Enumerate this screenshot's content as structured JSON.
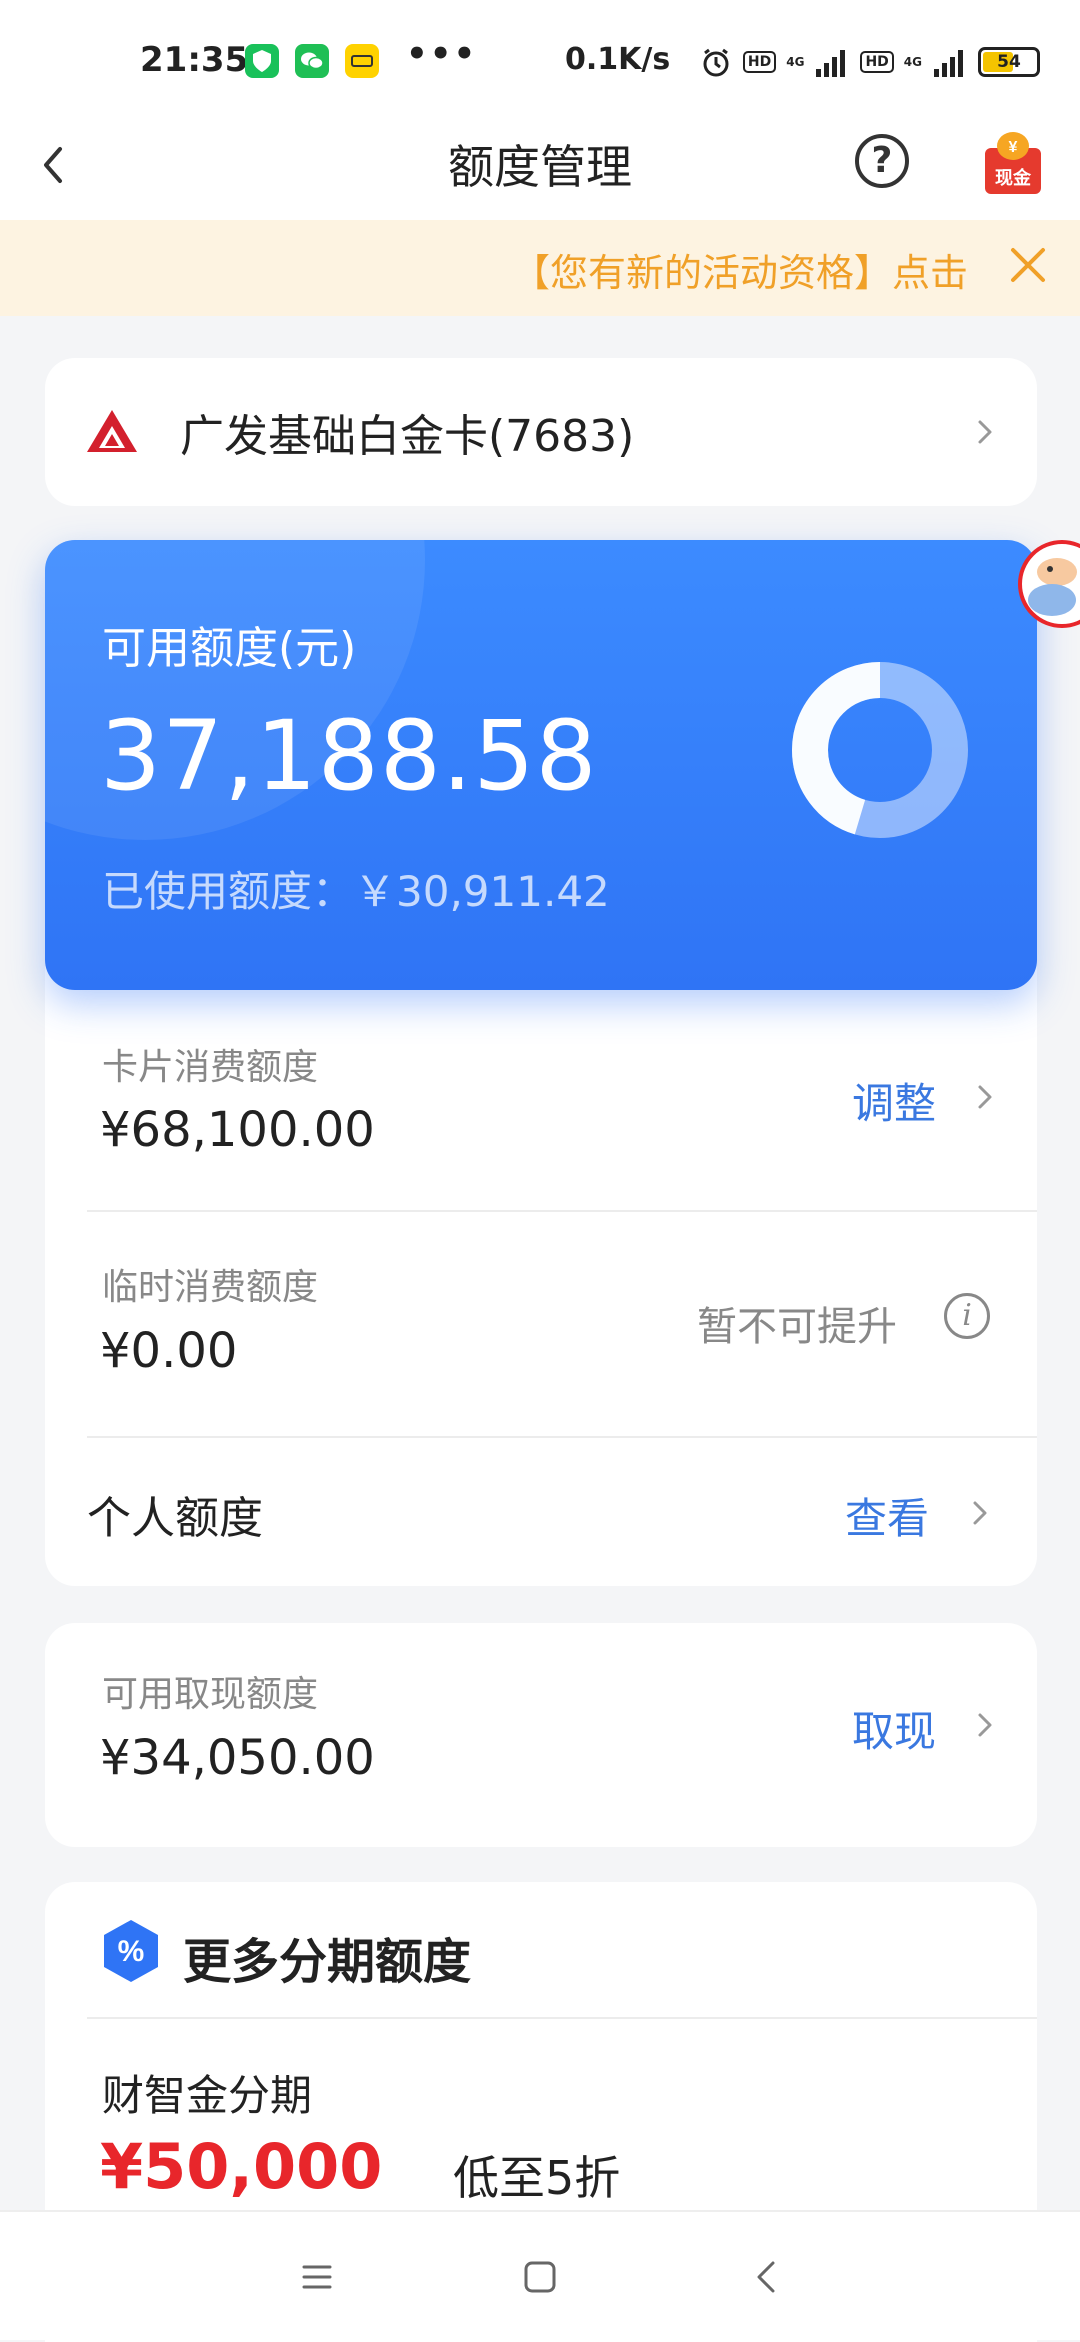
{
  "status_bar": {
    "time": "21:35",
    "net_speed": "0.1K/s",
    "hd1": "HD",
    "net1": "4G",
    "hd2": "HD",
    "net2": "4G",
    "battery": "54",
    "app_icons": [
      "shield-app-icon",
      "wechat-icon",
      "xianyu-app-icon"
    ],
    "app_colors": [
      "#19c15a",
      "#1fbf55",
      "#ffd200"
    ]
  },
  "nav": {
    "title": "额度管理",
    "help": "?",
    "cash_icon_text_1": "¥",
    "cash_icon_text_2": "现金"
  },
  "banner": {
    "text": "【您有新的活动资格】点击"
  },
  "card_select": {
    "name": "广发基础白金卡(7683)"
  },
  "available": {
    "label": "可用额度(元)",
    "amount": "37,188.58",
    "used_label": "已使用额度：",
    "used_amount": "￥30,911.42",
    "used_ratio": 0.454
  },
  "limits": {
    "card_limit_label": "卡片消费额度",
    "card_limit_value": "¥68,100.00",
    "card_limit_action": "调整",
    "temp_limit_label": "临时消费额度",
    "temp_limit_value": "¥0.00",
    "temp_limit_status": "暂不可提升",
    "personal_label": "个人额度",
    "personal_action": "查看"
  },
  "cash": {
    "label": "可用取现额度",
    "value": "¥34,050.00",
    "action": "取现"
  },
  "installment": {
    "title": "更多分期额度",
    "icon_text": "%",
    "product": "财智金分期",
    "amount": "¥50,000",
    "promo": "低至5折"
  },
  "colors": {
    "accent_blue": "#3a78e0",
    "card_blue": "#2f74f5",
    "banner_orange": "#f0a028",
    "amount_red": "#e8262b"
  }
}
